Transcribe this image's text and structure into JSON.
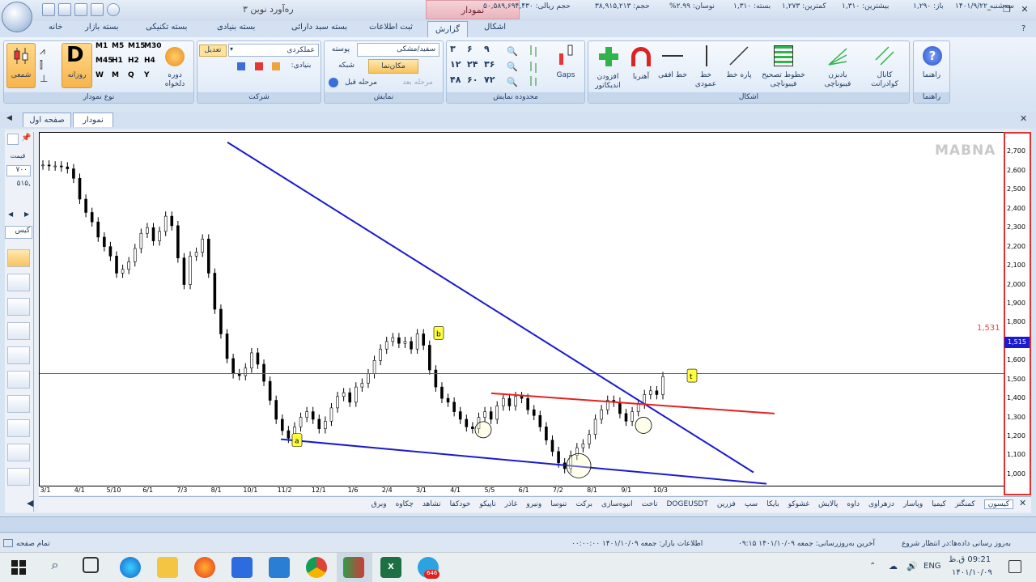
{
  "window": {
    "title": "ره‌آورد نوین ۳",
    "context_tab": "نمودار"
  },
  "ribbon_tabs": [
    "خانه",
    "بسته بازار",
    "بسته تکنیکی",
    "بسته بنیادی",
    "بسته سبد دارائی",
    "ثبت اطلاعات",
    "گزارش",
    "اشکال"
  ],
  "groups": {
    "chart_type": {
      "caption": "نوع نمودار",
      "candle": "شمعی",
      "daily_letter": "D",
      "daily": "روزانه",
      "custom_period": "دوره دلخواه",
      "periods": [
        "M1",
        "M5",
        "M15",
        "M30",
        "M45",
        "H1",
        "H2",
        "H4",
        "W",
        "M",
        "Q",
        "Y"
      ]
    },
    "company": {
      "caption": "شرکت",
      "select": "عملکردی",
      "adjust": "تعدیل",
      "fundamental": "بنیادی:"
    },
    "view": {
      "caption": "نمایش",
      "theme_label": "پوسته",
      "theme_value": "سفید/مشکی",
      "crosshair": "مکان‌نما",
      "grid": "شبکه",
      "prev_step": "مرحله قبل",
      "next_step": "مرحله بعد"
    },
    "range": {
      "caption": "محدوده نمایش",
      "items": [
        "۳",
        "۶",
        "۹",
        "۱۲",
        "۲۴",
        "۳۶",
        "۴۸",
        "۶۰",
        "۷۲"
      ],
      "gaps": "Gaps"
    },
    "shapes": {
      "caption": "اشکال",
      "add_indicator": "افزودن اندیکاتور",
      "magnet": "آهنربا",
      "h_line": "خط افقی",
      "v_line": "خط عمودی",
      "segment": "پاره خط",
      "fib_retrace": "خطوط تصحیح فیبوناچی",
      "fib_fan": "بادبزن فیبوناچی",
      "quad_channel": "کانال کوادرانت"
    },
    "help": {
      "caption": "راهنما",
      "label": "راهنما"
    }
  },
  "doc_tabs": [
    "نمودار",
    "صفحه اول"
  ],
  "left_panel": {
    "price_label": "قیمت",
    "price_value": "۷۰۰",
    "value2": "۵۱۵,",
    "search": "کیس"
  },
  "chart_data": {
    "type": "line",
    "title": "",
    "watermark": "MABNA",
    "xlabel": "",
    "ylabel": "",
    "ylim": [
      940,
      2800
    ],
    "y_ticks": [
      "1,000",
      "1,100",
      "1,200",
      "1,300",
      "1,400",
      "1,500",
      "1,600",
      "1,700",
      "1,800",
      "1,900",
      "2,000",
      "2,100",
      "2,200",
      "2,300",
      "2,400",
      "2,500",
      "2,600",
      "2,700"
    ],
    "x_ticks": [
      "3/1",
      "4/1",
      "5/10",
      "6/1",
      "7/3",
      "8/1",
      "10/1",
      "11/2",
      "12/1",
      "1/6",
      "2/4",
      "3/1",
      "4/1",
      "5/5",
      "6/1",
      "7/2",
      "8/1",
      "9/1",
      "10/3"
    ],
    "last_price_label": "1,515",
    "horizontal_line_label": "1,531",
    "annotations": [
      "a",
      "b",
      "t"
    ],
    "colors": {
      "price": "#000000",
      "trend_blue": "#1a1ad0",
      "resistance_red": "#e82020",
      "hline_green": "#2a8a2a",
      "last_price_bg": "#1a1ad0"
    },
    "series": [
      {
        "values": [
          2630,
          2625,
          2625,
          2620,
          2610,
          2560,
          2450,
          2380,
          2330,
          2250,
          2200,
          2150,
          2060,
          2080,
          2120,
          2190,
          2270,
          2300,
          2230,
          2280,
          2360,
          2310,
          2140,
          2000,
          2150,
          2170,
          2240,
          2060,
          1870,
          1740,
          1610,
          1530,
          1520,
          1560,
          1640,
          1580,
          1490,
          1390,
          1290,
          1230,
          1190,
          1250,
          1300,
          1330,
          1290,
          1240,
          1280,
          1350,
          1410,
          1430,
          1380,
          1460,
          1480,
          1530,
          1600,
          1660,
          1700,
          1720,
          1690,
          1700,
          1660,
          1740,
          1680,
          1550,
          1460,
          1400,
          1380,
          1330,
          1290,
          1250,
          1240,
          1300,
          1330,
          1290,
          1360,
          1400,
          1360,
          1410,
          1400,
          1340,
          1310,
          1250,
          1180,
          1120,
          1060,
          1030,
          1100,
          1140,
          1160,
          1210,
          1290,
          1340,
          1390,
          1380,
          1320,
          1280,
          1330,
          1370,
          1420,
          1440,
          1420,
          1515
        ]
      }
    ]
  },
  "symbols": [
    "کیسون",
    "کمنگنز",
    "کیمیا",
    "وپاسار",
    "دزهراوی",
    "داوه",
    "پالایش",
    "غشوکو",
    "بایکا",
    "سپ",
    "فزرین",
    "DOGEUSDT",
    "تاخت",
    "انبوه‌سازی",
    "برکت",
    "تنوسا",
    "ونیرو",
    "غاذر",
    "تاپیکو",
    "خودکفا",
    "تشاهد",
    "چکاوه",
    "وبرق"
  ],
  "stats": {
    "date": "سه‌شنبه ۱۴۰۱/۹/۲۲",
    "open": "باز: ۱,۲۹۰",
    "high": "بیشترین: ۱,۳۱۰",
    "low": "کمترین: ۱,۲۷۳",
    "close": "بسته: ۱,۳۱۰",
    "range": "نوسان: ۲.۹۹%",
    "volume": "حجم: ۳۸,۹۱۵,۲۱۳",
    "value": "حجم ریالی: ۵۰,۵۸۹,۶۹۴,۴۳۰"
  },
  "status": {
    "left": "تمام صفحه",
    "update": "به‌روز رسانی داده‌ها:در انتظار شروع",
    "last_update": "آخرین به‌روزرسانی: جمعه ۱۴۰۱/۱۰/۰۹ ۰۹:۱۵",
    "market": "اطلاعات بازار: جمعه ۱۴۰۱/۱۰/۰۹ ۰۰:۰۰:۰۰"
  },
  "taskbar": {
    "time": "09:21 ق.ظ",
    "date": "۱۴۰۱/۱۰/۰۹",
    "lang": "ENG",
    "badge": "646"
  }
}
